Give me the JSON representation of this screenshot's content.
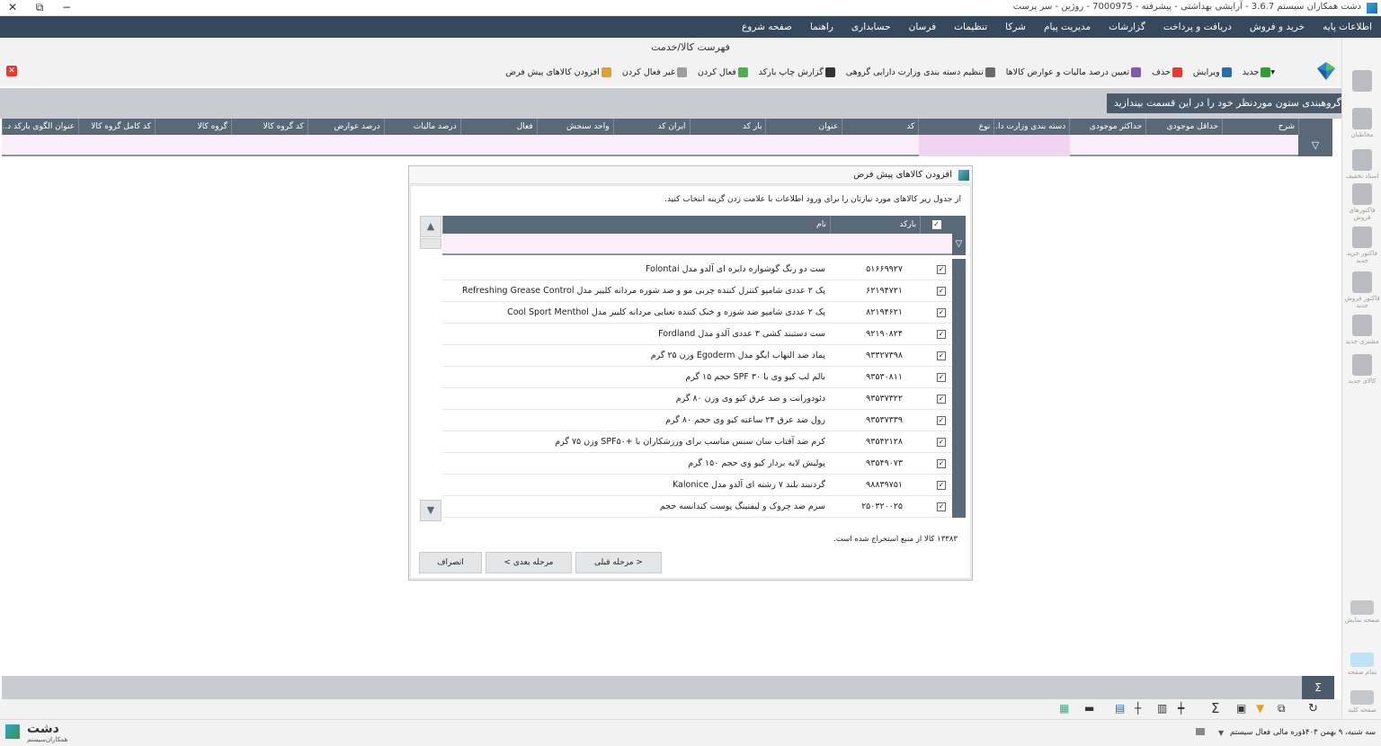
{
  "window": {
    "title": "دشت همکاران سیستم 3.6.7 - آرایشی بهداشتی - پیشرفته - 7000975 - روژین - سر پرست",
    "controls": [
      "✕",
      "⧉",
      "−"
    ]
  },
  "menu": [
    "اطلاعات پایه",
    "خرید و فروش",
    "دریافت و پرداخت",
    "گزارشات",
    "مدیریت پیام",
    "شرکا",
    "تنظیمات",
    "فرسان",
    "حسابداری",
    "راهنما",
    "صفحه شروع"
  ],
  "form_title": "فهرست کالا/خدمت",
  "toolbar": [
    {
      "label": "جدید",
      "icon": "plus-circle-icon",
      "color": "#2e9d3a"
    },
    {
      "label": "ویرایش",
      "icon": "pencil-icon",
      "color": "#1e6fb8"
    },
    {
      "label": "حذف",
      "icon": "delete-icon",
      "color": "#e53935"
    },
    {
      "label": "تعیین درصد مالیات و عوارض کالاها",
      "icon": "percent-icon",
      "color": "#7b5ea7"
    },
    {
      "label": "تنظیم دسته بندی وزارت دارایی گروهی",
      "icon": "settings-icon",
      "color": "#6a6a6a"
    },
    {
      "label": "گزارش چاپ بارکد",
      "icon": "barcode-icon",
      "color": "#333333"
    },
    {
      "label": "فعال کردن",
      "icon": "activate-icon",
      "color": "#4caf50"
    },
    {
      "label": "غیر فعال کردن",
      "icon": "deactivate-icon",
      "color": "#9e9e9e"
    },
    {
      "label": "افزودن کالاهای پیش فرض",
      "icon": "box-add-icon",
      "color": "#e0a030"
    }
  ],
  "group_hint": "جهت گروهبندی ستون موردنظر خود را در این قسمت بیندازید",
  "columns": [
    "شرح",
    "حداقل موجودی",
    "حداکثر موجودی",
    "دسته بندی وزارت دا...",
    "نوع",
    "کد",
    "عنوان",
    "بار کد",
    "ایران کد",
    "واحد سنجش",
    "فعال",
    "درصد مالیات",
    "درصد عوارض",
    "کد گروه کالا",
    "گروه کالا",
    "کد  کامل گروه کالا",
    "عنوان الگوی بارکد د..."
  ],
  "sidebar": [
    {
      "label": "",
      "icon": "user-icon"
    },
    {
      "label": "مخاطبان",
      "icon": "contacts-icon"
    },
    {
      "label": "اسناد تخفیف",
      "icon": "discount-icon"
    },
    {
      "label": "فاکتورهای فروش",
      "icon": "invoices-icon"
    },
    {
      "label": "فاکتور خرید جدید",
      "icon": "purchase-icon"
    },
    {
      "label": "فاکتور فروش جدید",
      "icon": "sale-icon"
    },
    {
      "label": "مشتری جدید",
      "icon": "customer-add-icon"
    },
    {
      "label": "کالای جدید",
      "icon": "product-add-icon"
    },
    {
      "label": "صفحه نمایش",
      "icon": "screen-icon"
    },
    {
      "label": "تمام صفحه",
      "icon": "fullscreen-icon"
    },
    {
      "label": "صفحه کلید",
      "icon": "keyboard-icon"
    }
  ],
  "dialog": {
    "title": "افزودن کالاهای پیش فرض",
    "instructions": "از جدول زیر کالاهای مورد نیازتان را برای ورود اطلاعات با علامت زدن گزینه انتخاب کنید.",
    "col_barcode": "بارکد",
    "col_name": "نام",
    "rows": [
      {
        "barcode": "۵۱۶۶۹۹۲۷",
        "name": "ست دو رنگ گوشواره دایره ای آلدو مدل Folontai"
      },
      {
        "barcode": "۶۲۱۹۴۷۲۱",
        "name": "پک ۲ عددی شامپو کنترل کننده چربی مو و ضد شوره مردانه کلییر مدل Refreshing Grease Control"
      },
      {
        "barcode": "۸۲۱۹۴۶۲۱",
        "name": "پک ۲ عددی شامپو ضد شوره و خنک کننده نعنایی مردانه کلییر مدل Cool Sport Menthol"
      },
      {
        "barcode": "۹۲۱۹۰۸۲۴",
        "name": "ست دستبند کشی ۳ عددی آلدو مدل Fordland"
      },
      {
        "barcode": "۹۳۳۲۷۳۹۸",
        "name": "پماد ضد التهاب ایگو مدل Egoderm وزن ۲۵ گرم"
      },
      {
        "barcode": "۹۳۵۳۰۸۱۱",
        "name": "بالم لب کیو وی با SPF ۳۰ حجم ۱۵ گرم"
      },
      {
        "barcode": "۹۳۵۳۷۳۲۲",
        "name": "دئودورانت و ضد عرق کیو وی وزن ۸۰ گرم"
      },
      {
        "barcode": "۹۳۵۳۷۳۳۹",
        "name": "رول ضد عرق ۲۴ ساعته کیو وی حجم ۸۰ گرم"
      },
      {
        "barcode": "۹۳۵۴۲۱۲۸",
        "name": "کرم ضد آفتاب سان سنس مناسب برای ورزشکاران با +SPF۵۰ وزن ۷۵ گرم"
      },
      {
        "barcode": "۹۳۵۴۹۰۷۳",
        "name": "پولیش لایه بردار کیو وی حجم ۱۵۰ گرم"
      },
      {
        "barcode": "۹۸۸۳۹۷۵۱",
        "name": "گردنبند بلند ۷ رشته ای آلدو مدل Kalonice"
      },
      {
        "barcode": "۲۵۰۳۲۰۰۲۵",
        "name": "سرم ضد چروک و لیفتینگ پوست کندانسه حجم"
      }
    ],
    "count_text": "۱۳۳۸۳ کالا از منبع استخراج شده است.",
    "btn_prev": "< مرحله قبلی",
    "btn_next": "مرحله بعدی >",
    "btn_cancel": "انصراف"
  },
  "status": {
    "date": "سه شنبه، ۹ بهمن ۱۴۰۳",
    "fiscal": "دوره مالی فعال سیستم",
    "brand": "دشت",
    "brand_sub": "همکاران‌سیستم"
  }
}
